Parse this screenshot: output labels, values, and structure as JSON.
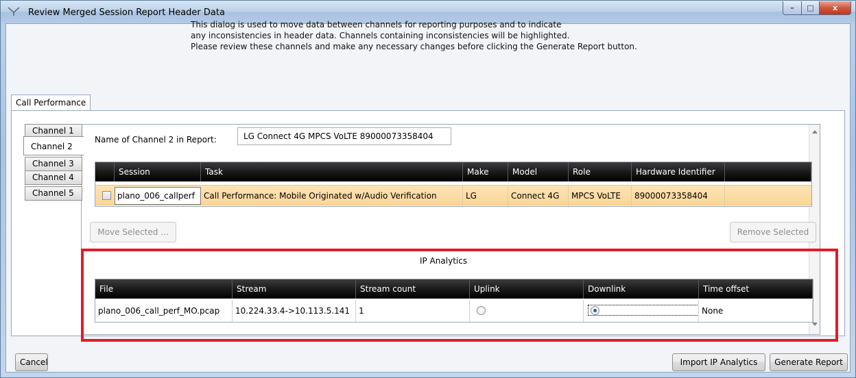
{
  "window": {
    "title": "Review Merged Session Report Header Data",
    "controls": {
      "minimize": "–",
      "maximize": "□",
      "close": "x"
    }
  },
  "intro": {
    "lines": [
      "This dialog is used to move data between channels for reporting purposes and to indicate",
      "any inconsistencies in header data. Channels containing inconsistencies will be highlighted.",
      "Please review these channels and make any necessary changes before clicking the Generate Report button."
    ]
  },
  "main_tab": {
    "label": "Call Performance"
  },
  "channel_tabs": [
    "Channel 1",
    "Channel 2",
    "Channel 3",
    "Channel 4",
    "Channel 5"
  ],
  "active_channel_index": 1,
  "channel_name": {
    "label": "Name of Channel 2 in Report:",
    "value": "LG Connect 4G MPCS VoLTE 89000073358404"
  },
  "session_grid": {
    "headers": [
      "Session",
      "Task",
      "Make",
      "Model",
      "Role",
      "Hardware Identifier"
    ],
    "row": {
      "checked": false,
      "session": "plano_006_callperf",
      "task": "Call Performance: Mobile Originated w/Audio Verification",
      "make": "LG",
      "model": "Connect 4G",
      "role": "MPCS VoLTE",
      "hardware_identifier": "89000073358404"
    }
  },
  "buttons": {
    "move_selected": "Move Selected ...",
    "remove_selected": "Remove Selected",
    "cancel": "Cancel",
    "import_ip": "Import IP Analytics",
    "generate_report": "Generate Report"
  },
  "ip_analytics": {
    "title": "IP Analytics",
    "headers": [
      "File",
      "Stream",
      "Stream count",
      "Uplink",
      "Downlink",
      "Time offset"
    ],
    "row": {
      "file": "plano_006_call_perf_MO.pcap",
      "stream": "10.224.33.4->10.113.5.141",
      "stream_count": "1",
      "uplink_selected": false,
      "downlink_selected": true,
      "time_offset": "None"
    }
  },
  "colors": {
    "highlight_border": "#e01c2a",
    "selected_row": "#fcd699",
    "grid_header": "#000000"
  }
}
